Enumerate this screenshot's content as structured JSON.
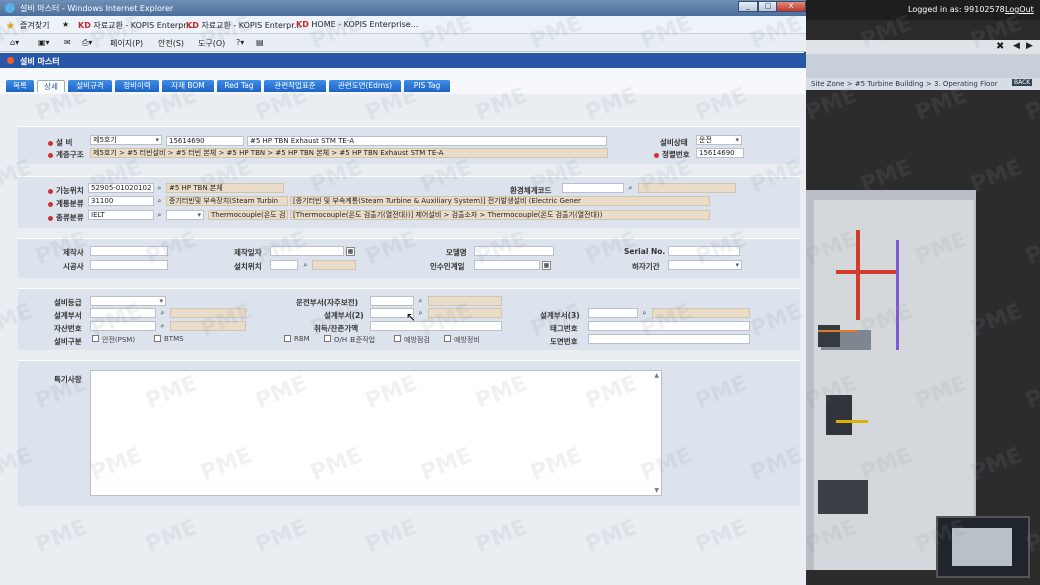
{
  "window": {
    "title": "설비 마스터 - Windows Internet Explorer",
    "favorites": "즐겨찾기",
    "fav_tabs": [
      "자료교환 - KOPIS Enterpr...",
      "자료교환 - KOPIS Enterpr...",
      "HOME - KOPIS Enterprise..."
    ],
    "cmd": [
      "페이지(P)",
      "안전(S)",
      "도구(O)"
    ],
    "controls": {
      "minimize": "_",
      "maximize": "□",
      "close": "X"
    }
  },
  "background_app": {
    "logged_in": "Logged in as: 99102578",
    "logout": "LogOut",
    "breadcrumb": "Site Zone > #5 Turbine Building > 3. Operating Floor",
    "back": "BACK"
  },
  "page": {
    "title": "설비 마스터",
    "tabs": [
      "목록",
      "상세",
      "설비규격",
      "정비이력",
      "자재 BOM",
      "Red Tag",
      "관련작업표준",
      "관련도면(Edms)",
      "PIS Tag"
    ],
    "active_tab_index": 1
  },
  "sec1": {
    "equipment_label": "설 비",
    "unit_select": "제5호기",
    "equipment_code": "15614690",
    "equipment_name": "#5 HP TBN Exhaust STM TE-A",
    "status_label": "설비상태",
    "status_value": "운전",
    "hierarchy_label": "계층구조",
    "hierarchy_value": "제5호기 > #5 터빈설비 > #5 터빈 본체 > #5 HP TBN > #5 HP TBN 본체 > #5 HP TBN Exhaust STM TE-A",
    "control_no_label": "정렬번호",
    "control_no_value": "15614690"
  },
  "sec2": {
    "function_label": "기능위치",
    "function_code": "52905-01020102",
    "function_name": "#5 HP TBN 본체",
    "env_label": "환경체계코드",
    "system_label": "계통분류",
    "system_code": "31100",
    "system_name": "증기터빈및 부속장치(Steam Turbin",
    "system_desc": "[증기터빈 및 부속계통(Steam Turbine & Auxiliary System)] 전기발생설비 (Electric Gener",
    "type_label": "종류분류",
    "type_code": "IELT",
    "type_name": "Thermocouple(온도 검",
    "type_desc": "[Thermocouple(온도 검출기(열전대))] 제어설비 > 검출소자 > Thermocouple(온도 검출기(열전대))"
  },
  "sec3": {
    "maker_label": "제작사",
    "make_date_label": "제작일자",
    "model_label": "모델명",
    "serial_label": "Serial No.",
    "contractor_label": "시공사",
    "install_loc_label": "설치위치",
    "handover_label": "인수인계일",
    "warranty_label": "하자기간"
  },
  "sec4": {
    "grade_label": "설비등급",
    "operate_dept_label": "운전부서(자주보전)",
    "design_dept_label": "설계부서",
    "design_dept2_label": "설계부서(2)",
    "design_dept3_label": "설계부서(3)",
    "asset_no_label": "자산번호",
    "acq_value_label": "취득/잔존가액",
    "tag_no_label": "태그번호",
    "category_label": "설비구분",
    "checks": [
      "안전(PSM)",
      "BTMS",
      "RBM",
      "O/H 표준작업",
      "예방점검",
      "예방정비"
    ],
    "drawing_no_label": "도면번호"
  },
  "sec5": {
    "notes_label": "특기사항"
  },
  "watermark": "PME"
}
